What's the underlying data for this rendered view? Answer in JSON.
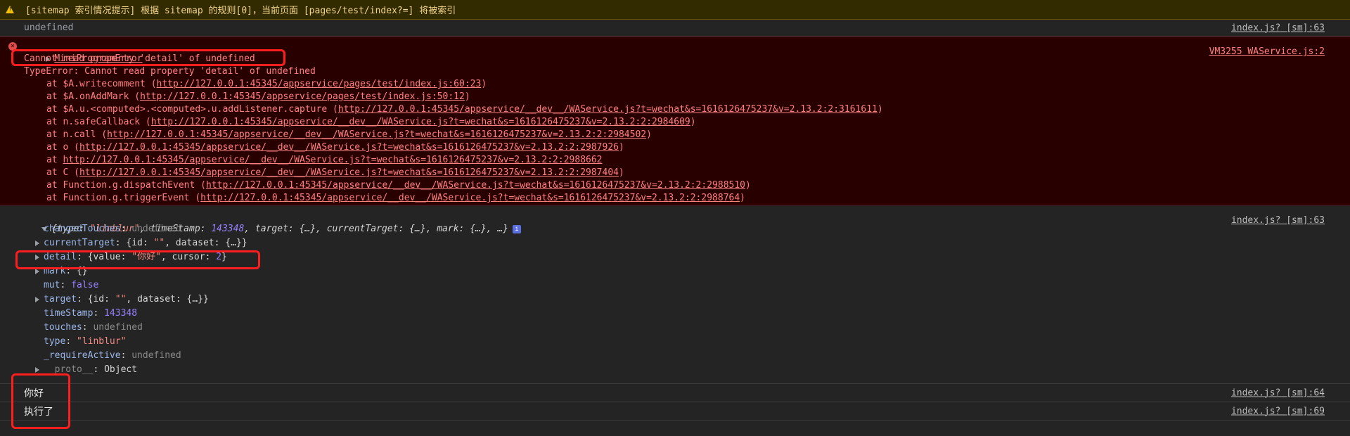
{
  "warning": {
    "text": "[sitemap 索引情况提示] 根据 sitemap 的规则[0]，当前页面 [pages/test/index?=] 将被索引"
  },
  "undefined_row": {
    "text": "undefined",
    "source": "index.js? [sm]:63"
  },
  "error": {
    "title": "MiniProgramError",
    "source": "VM3255 WAService.js:2",
    "message": "Cannot read property 'detail' of undefined",
    "type_line": "TypeError: Cannot read property 'detail' of undefined",
    "stack": [
      {
        "prefix": "at $A.writecomment (",
        "url": "http://127.0.0.1:45345/appservice/pages/test/index.js:60:23",
        "suffix": ")"
      },
      {
        "prefix": "at $A.onAddMark (",
        "url": "http://127.0.0.1:45345/appservice/pages/test/index.js:50:12",
        "suffix": ")"
      },
      {
        "prefix": "at $A.u.<computed>.<computed>.u.addListener.capture (",
        "url": "http://127.0.0.1:45345/appservice/__dev__/WAService.js?t=wechat&s=1616126475237&v=2.13.2:2:3161611",
        "suffix": ")"
      },
      {
        "prefix": "at n.safeCallback (",
        "url": "http://127.0.0.1:45345/appservice/__dev__/WAService.js?t=wechat&s=1616126475237&v=2.13.2:2:2984609",
        "suffix": ")"
      },
      {
        "prefix": "at n.call (",
        "url": "http://127.0.0.1:45345/appservice/__dev__/WAService.js?t=wechat&s=1616126475237&v=2.13.2:2:2984502",
        "suffix": ")"
      },
      {
        "prefix": "at o (",
        "url": "http://127.0.0.1:45345/appservice/__dev__/WAService.js?t=wechat&s=1616126475237&v=2.13.2:2:2987926",
        "suffix": ")"
      },
      {
        "prefix": "at ",
        "url": "http://127.0.0.1:45345/appservice/__dev__/WAService.js?t=wechat&s=1616126475237&v=2.13.2:2:2988662",
        "suffix": ""
      },
      {
        "prefix": "at C (",
        "url": "http://127.0.0.1:45345/appservice/__dev__/WAService.js?t=wechat&s=1616126475237&v=2.13.2:2:2987404",
        "suffix": ")"
      },
      {
        "prefix": "at Function.g.dispatchEvent (",
        "url": "http://127.0.0.1:45345/appservice/__dev__/WAService.js?t=wechat&s=1616126475237&v=2.13.2:2:2988510",
        "suffix": ")"
      },
      {
        "prefix": "at Function.g.triggerEvent (",
        "url": "http://127.0.0.1:45345/appservice/__dev__/WAService.js?t=wechat&s=1616126475237&v=2.13.2:2:2988764",
        "suffix": ")"
      }
    ]
  },
  "object": {
    "source": "index.js? [sm]:63",
    "summary": {
      "open": "{",
      "type_key": "type",
      "type_val": "\"linblur\"",
      "ts_key": "timeStamp",
      "ts_val": "143348",
      "rest": ", target: {…}, currentTarget: {…}, mark: {…}, …}",
      "badge": "i"
    },
    "props": {
      "changedTouches": {
        "key": "changedTouches",
        "val": "undefined"
      },
      "currentTarget": {
        "key": "currentTarget",
        "pre": "{id: ",
        "id": "\"\"",
        "post": ", dataset: {…}}"
      },
      "detail": {
        "key": "detail",
        "pre": "{value: ",
        "value": "\"你好\"",
        "mid": ", cursor: ",
        "cursor": "2",
        "post": "}"
      },
      "mark": {
        "key": "mark",
        "val": "{}"
      },
      "mut": {
        "key": "mut",
        "val": "false"
      },
      "target": {
        "key": "target",
        "pre": "{id: ",
        "id": "\"\"",
        "post": ", dataset: {…}}"
      },
      "timeStamp": {
        "key": "timeStamp",
        "val": "143348"
      },
      "touches": {
        "key": "touches",
        "val": "undefined"
      },
      "type": {
        "key": "type",
        "val": "\"linblur\""
      },
      "requireActive": {
        "key": "_requireActive",
        "val": "undefined"
      },
      "proto": {
        "key": "__proto__",
        "val": "Object"
      }
    }
  },
  "logs": [
    {
      "text": "你好",
      "source": "index.js? [sm]:64"
    },
    {
      "text": "执行了",
      "source": "index.js? [sm]:69"
    }
  ],
  "colors": {
    "highlight": "#ff1e1e",
    "error_bg": "#290000",
    "warning_bg": "#332b00"
  }
}
